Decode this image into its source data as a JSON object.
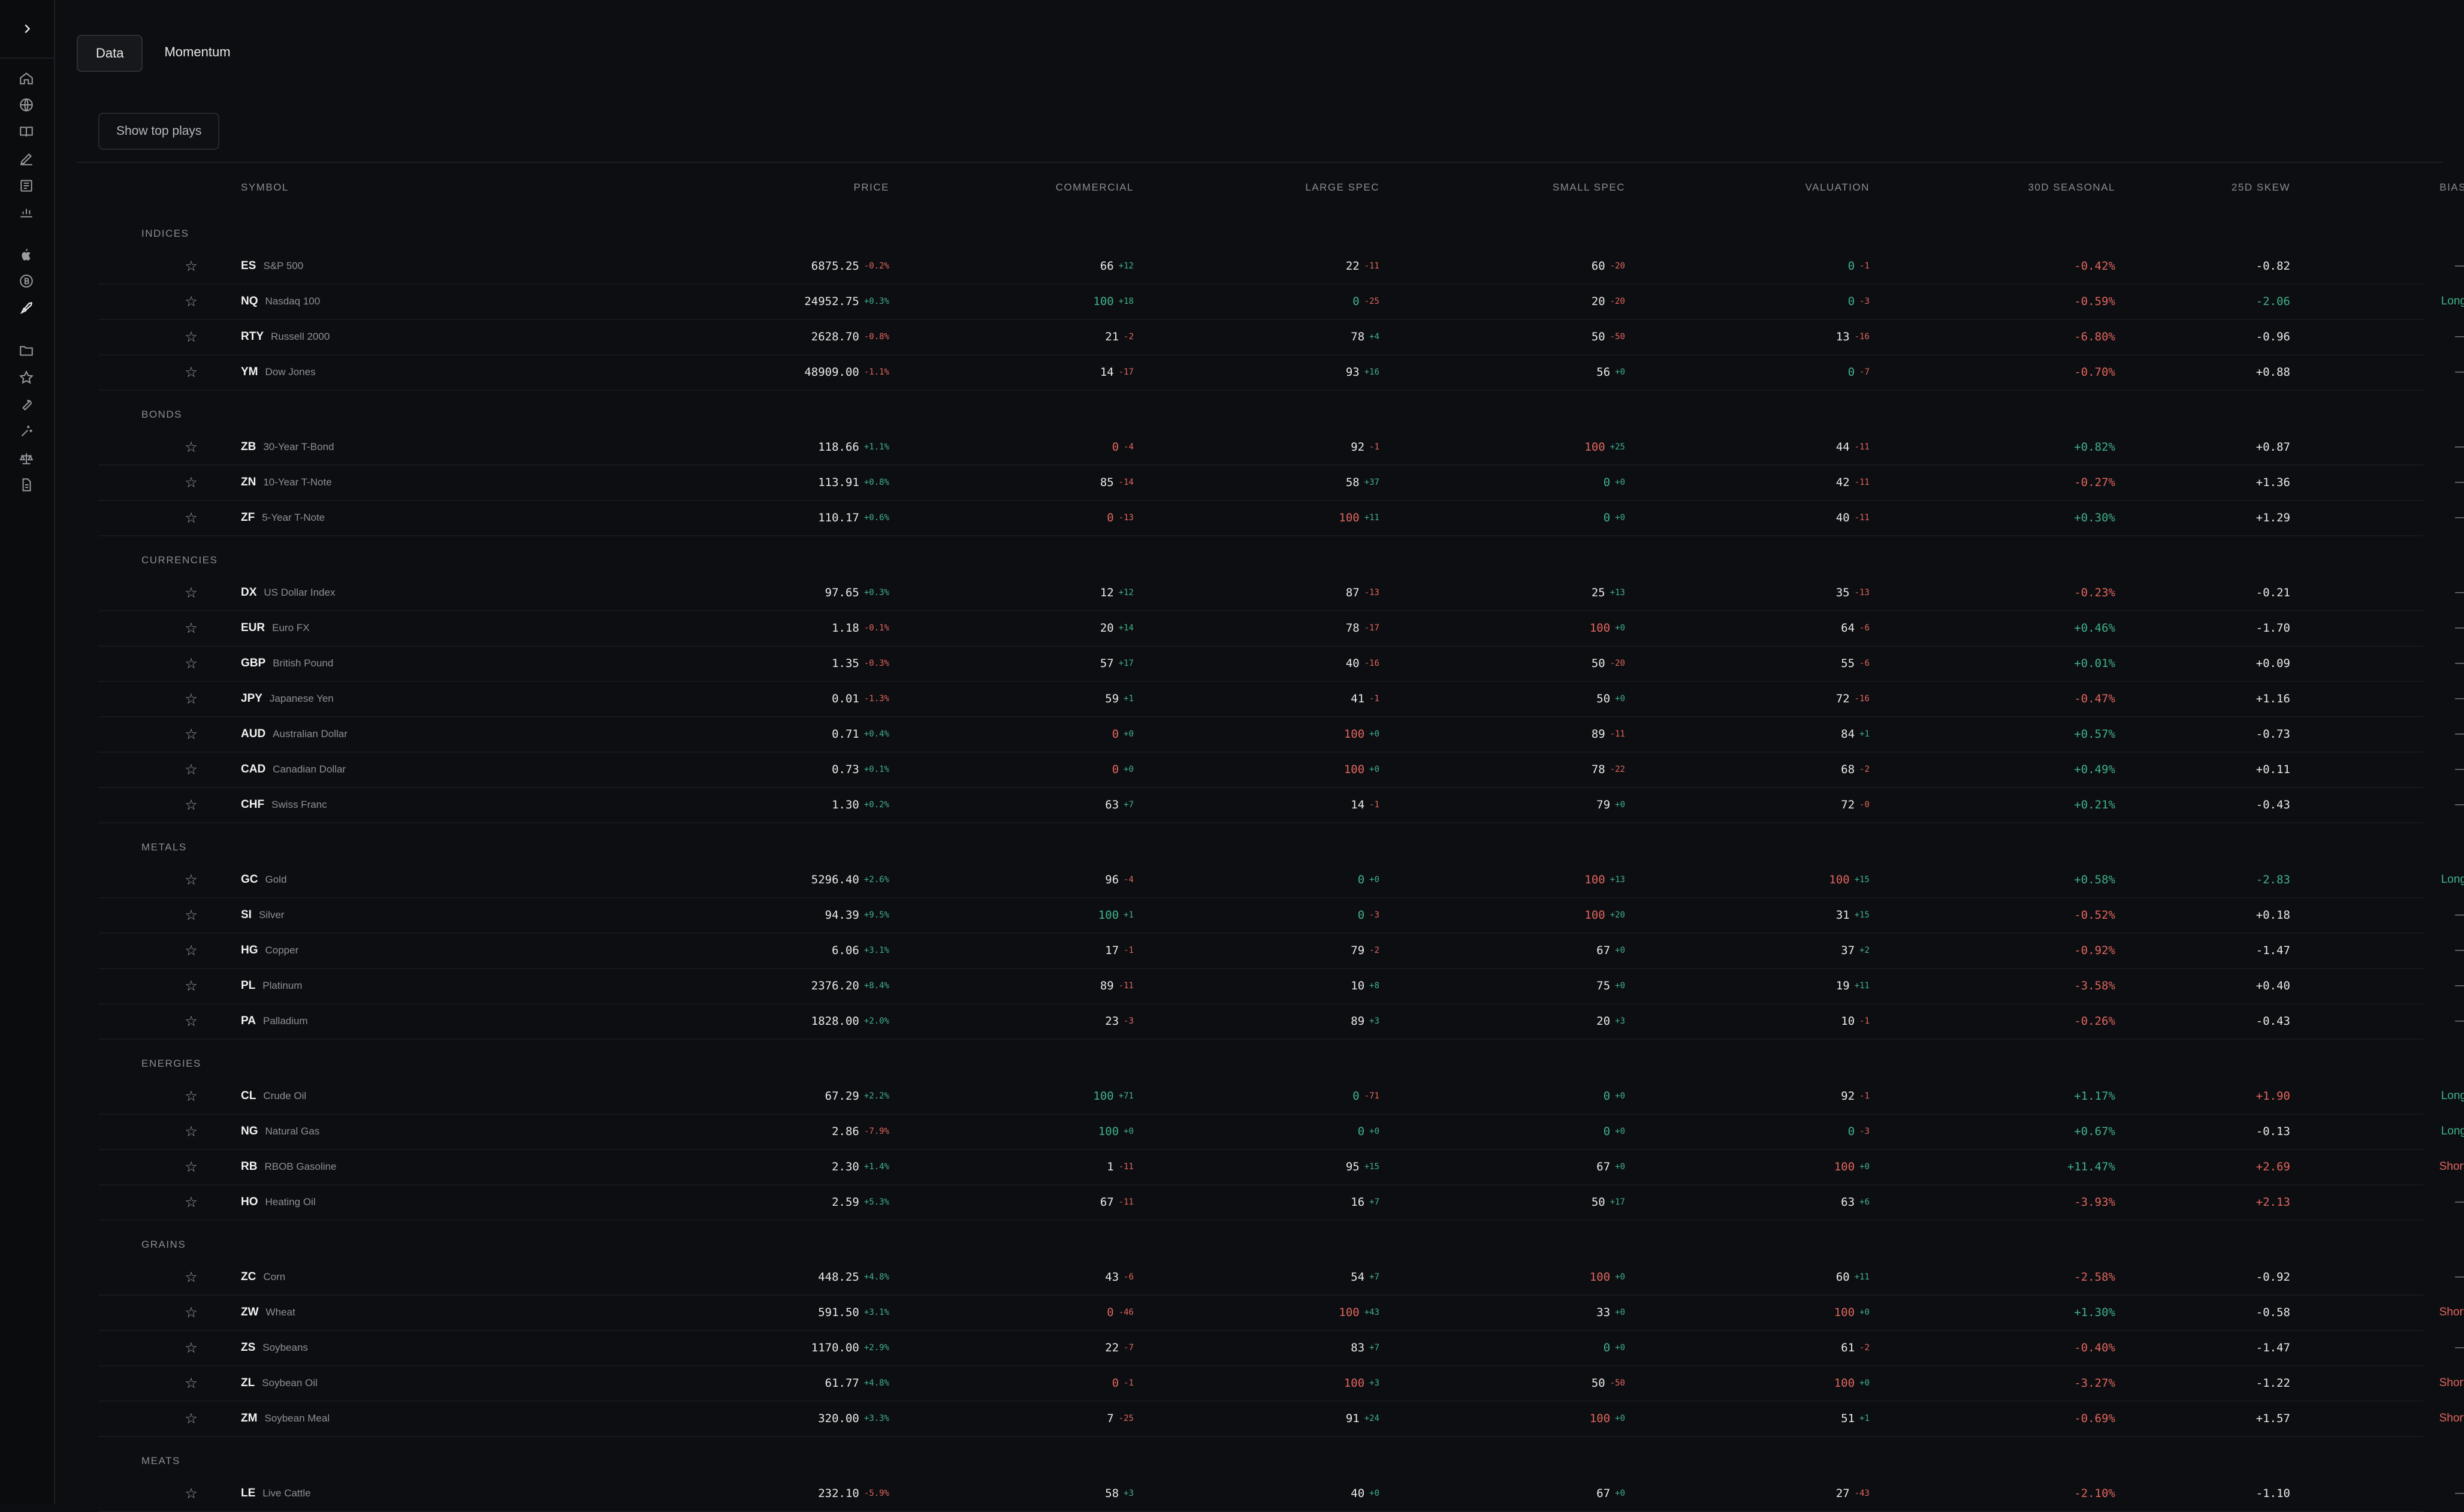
{
  "tabs": [
    "Data",
    "Momentum"
  ],
  "show_top_plays": "Show top plays",
  "columns": {
    "symbol": "SYMBOL",
    "price": "PRICE",
    "commercial": "COMMERCIAL",
    "large_spec": "LARGE SPEC",
    "small_spec": "SMALL SPEC",
    "valuation": "VALUATION",
    "seasonal": "30D SEASONAL",
    "skew": "25D SKEW",
    "bias": "BIAS"
  },
  "colors": {
    "positive": "#3fb08c",
    "negative": "#e0655f",
    "neutral": "#8a8c91"
  },
  "groups": [
    {
      "name": "INDICES",
      "rows": [
        [
          "ES",
          "S&P 500",
          "6875.25",
          "-0.2%",
          "66",
          "+12",
          "22",
          "-11",
          "60",
          "-20",
          "0",
          "-1",
          "-0.42%",
          "-0.82",
          "—"
        ],
        [
          "NQ",
          "Nasdaq 100",
          "24952.75",
          "+0.3%",
          "100",
          "+18",
          "0",
          "-25",
          "20",
          "-20",
          "0",
          "-3",
          "-0.59%",
          "-2.06",
          "Long"
        ],
        [
          "RTY",
          "Russell 2000",
          "2628.70",
          "-0.8%",
          "21",
          "-2",
          "78",
          "+4",
          "50",
          "-50",
          "13",
          "-16",
          "-6.80%",
          "-0.96",
          "—"
        ],
        [
          "YM",
          "Dow Jones",
          "48909.00",
          "-1.1%",
          "14",
          "-17",
          "93",
          "+16",
          "56",
          "+0",
          "0",
          "-7",
          "-0.70%",
          "+0.88",
          "—"
        ]
      ]
    },
    {
      "name": "BONDS",
      "rows": [
        [
          "ZB",
          "30-Year T-Bond",
          "118.66",
          "+1.1%",
          "0",
          "-4",
          "92",
          "-1",
          "100",
          "+25",
          "44",
          "-11",
          "+0.82%",
          "+0.87",
          "—"
        ],
        [
          "ZN",
          "10-Year T-Note",
          "113.91",
          "+0.8%",
          "85",
          "-14",
          "58",
          "+37",
          "0",
          "+0",
          "42",
          "-11",
          "-0.27%",
          "+1.36",
          "—"
        ],
        [
          "ZF",
          "5-Year T-Note",
          "110.17",
          "+0.6%",
          "0",
          "-13",
          "100",
          "+11",
          "0",
          "+0",
          "40",
          "-11",
          "+0.30%",
          "+1.29",
          "—"
        ]
      ]
    },
    {
      "name": "CURRENCIES",
      "rows": [
        [
          "DX",
          "US Dollar Index",
          "97.65",
          "+0.3%",
          "12",
          "+12",
          "87",
          "-13",
          "25",
          "+13",
          "35",
          "-13",
          "-0.23%",
          "-0.21",
          "—"
        ],
        [
          "EUR",
          "Euro FX",
          "1.18",
          "-0.1%",
          "20",
          "+14",
          "78",
          "-17",
          "100",
          "+0",
          "64",
          "-6",
          "+0.46%",
          "-1.70",
          "—"
        ],
        [
          "GBP",
          "British Pound",
          "1.35",
          "-0.3%",
          "57",
          "+17",
          "40",
          "-16",
          "50",
          "-20",
          "55",
          "-6",
          "+0.01%",
          "+0.09",
          "—"
        ],
        [
          "JPY",
          "Japanese Yen",
          "0.01",
          "-1.3%",
          "59",
          "+1",
          "41",
          "-1",
          "50",
          "+0",
          "72",
          "-16",
          "-0.47%",
          "+1.16",
          "—"
        ],
        [
          "AUD",
          "Australian Dollar",
          "0.71",
          "+0.4%",
          "0",
          "+0",
          "100",
          "+0",
          "89",
          "-11",
          "84",
          "+1",
          "+0.57%",
          "-0.73",
          "—"
        ],
        [
          "CAD",
          "Canadian Dollar",
          "0.73",
          "+0.1%",
          "0",
          "+0",
          "100",
          "+0",
          "78",
          "-22",
          "68",
          "-2",
          "+0.49%",
          "+0.11",
          "—"
        ],
        [
          "CHF",
          "Swiss Franc",
          "1.30",
          "+0.2%",
          "63",
          "+7",
          "14",
          "-1",
          "79",
          "+0",
          "72",
          "-0",
          "+0.21%",
          "-0.43",
          "—"
        ]
      ]
    },
    {
      "name": "METALS",
      "rows": [
        [
          "GC",
          "Gold",
          "5296.40",
          "+2.6%",
          "96",
          "-4",
          "0",
          "+0",
          "100",
          "+13",
          "100",
          "+15",
          "+0.58%",
          "-2.83",
          "Long"
        ],
        [
          "SI",
          "Silver",
          "94.39",
          "+9.5%",
          "100",
          "+1",
          "0",
          "-3",
          "100",
          "+20",
          "31",
          "+15",
          "-0.52%",
          "+0.18",
          "—"
        ],
        [
          "HG",
          "Copper",
          "6.06",
          "+3.1%",
          "17",
          "-1",
          "79",
          "-2",
          "67",
          "+0",
          "37",
          "+2",
          "-0.92%",
          "-1.47",
          "—"
        ],
        [
          "PL",
          "Platinum",
          "2376.20",
          "+8.4%",
          "89",
          "-11",
          "10",
          "+8",
          "75",
          "+0",
          "19",
          "+11",
          "-3.58%",
          "+0.40",
          "—"
        ],
        [
          "PA",
          "Palladium",
          "1828.00",
          "+2.0%",
          "23",
          "-3",
          "89",
          "+3",
          "20",
          "+3",
          "10",
          "-1",
          "-0.26%",
          "-0.43",
          "—"
        ]
      ]
    },
    {
      "name": "ENERGIES",
      "rows": [
        [
          "CL",
          "Crude Oil",
          "67.29",
          "+2.2%",
          "100",
          "+71",
          "0",
          "-71",
          "0",
          "+0",
          "92",
          "-1",
          "+1.17%",
          "+1.90",
          "Long"
        ],
        [
          "NG",
          "Natural Gas",
          "2.86",
          "-7.9%",
          "100",
          "+0",
          "0",
          "+0",
          "0",
          "+0",
          "0",
          "-3",
          "+0.67%",
          "-0.13",
          "Long"
        ],
        [
          "RB",
          "RBOB Gasoline",
          "2.30",
          "+1.4%",
          "1",
          "-11",
          "95",
          "+15",
          "67",
          "+0",
          "100",
          "+0",
          "+11.47%",
          "+2.69",
          "Short"
        ],
        [
          "HO",
          "Heating Oil",
          "2.59",
          "+5.3%",
          "67",
          "-11",
          "16",
          "+7",
          "50",
          "+17",
          "63",
          "+6",
          "-3.93%",
          "+2.13",
          "—"
        ]
      ]
    },
    {
      "name": "GRAINS",
      "rows": [
        [
          "ZC",
          "Corn",
          "448.25",
          "+4.8%",
          "43",
          "-6",
          "54",
          "+7",
          "100",
          "+0",
          "60",
          "+11",
          "-2.58%",
          "-0.92",
          "—"
        ],
        [
          "ZW",
          "Wheat",
          "591.50",
          "+3.1%",
          "0",
          "-46",
          "100",
          "+43",
          "33",
          "+0",
          "100",
          "+0",
          "+1.30%",
          "-0.58",
          "Short"
        ],
        [
          "ZS",
          "Soybeans",
          "1170.00",
          "+2.9%",
          "22",
          "-7",
          "83",
          "+7",
          "0",
          "+0",
          "61",
          "-2",
          "-0.40%",
          "-1.47",
          "—"
        ],
        [
          "ZL",
          "Soybean Oil",
          "61.77",
          "+4.8%",
          "0",
          "-1",
          "100",
          "+3",
          "50",
          "-50",
          "100",
          "+0",
          "-3.27%",
          "-1.22",
          "Short"
        ],
        [
          "ZM",
          "Soybean Meal",
          "320.00",
          "+3.3%",
          "7",
          "-25",
          "91",
          "+24",
          "100",
          "+0",
          "51",
          "+1",
          "-0.69%",
          "+1.57",
          "Short"
        ]
      ]
    },
    {
      "name": "MEATS",
      "rows": [
        [
          "LE",
          "Live Cattle",
          "232.10",
          "-5.9%",
          "58",
          "+3",
          "40",
          "+0",
          "67",
          "+0",
          "27",
          "-43",
          "-2.10%",
          "-1.10",
          "—"
        ]
      ]
    }
  ]
}
